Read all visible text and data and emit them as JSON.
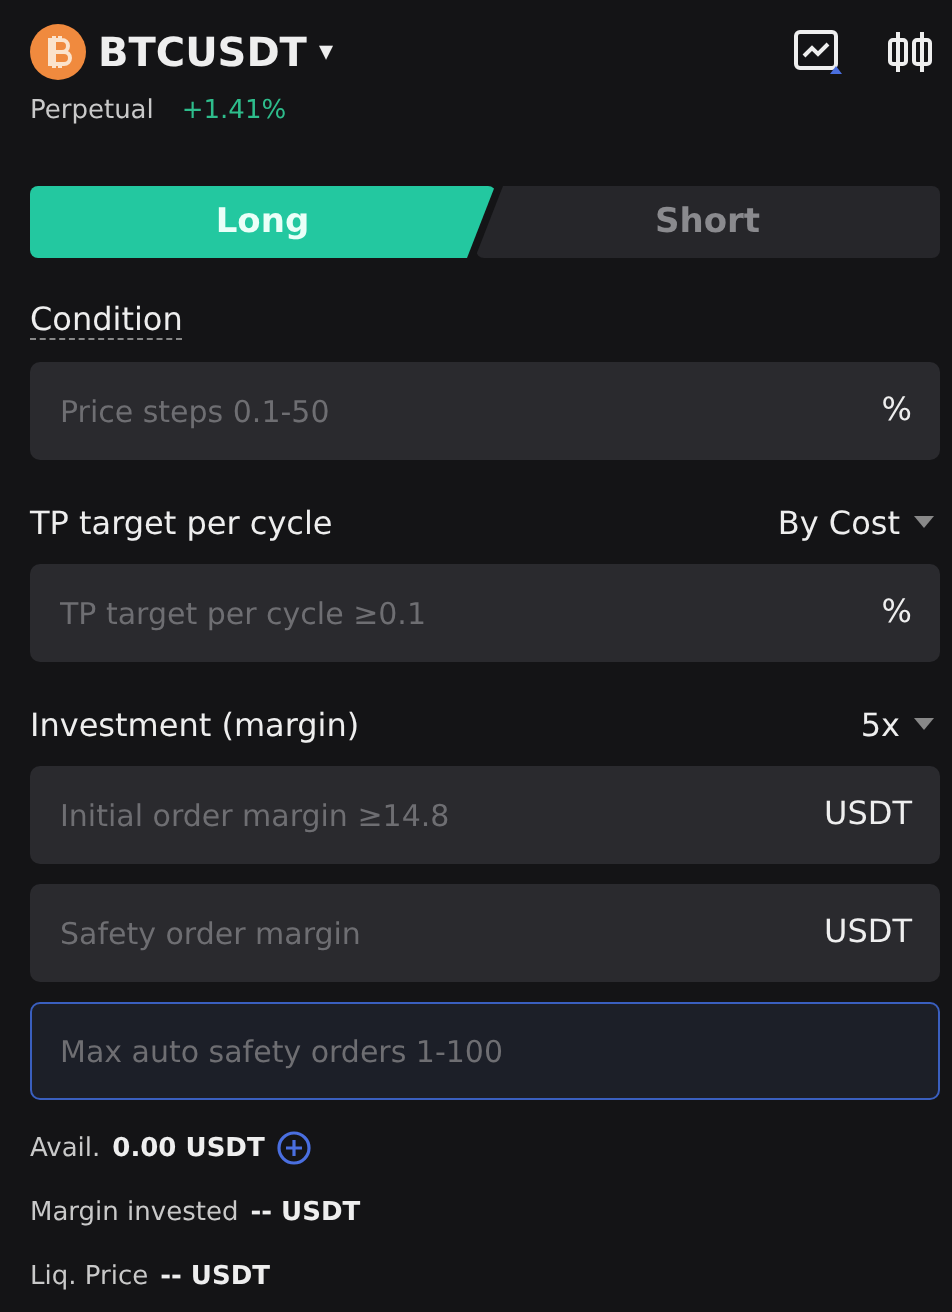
{
  "header": {
    "symbol": "BTCUSDT",
    "caret": "▾",
    "type": "Perpetual",
    "change": "+1.41%"
  },
  "tabs": [
    {
      "label": "Long",
      "selected": true
    },
    {
      "label": "Short",
      "selected": false
    }
  ],
  "sections": [
    {
      "label": "Condition",
      "underlined": true,
      "fields": [
        {
          "placeholder": "Price steps 0.1-50",
          "unit": "%",
          "focused": false
        }
      ]
    },
    {
      "label": "TP target per cycle",
      "underlined": false,
      "select": "By Cost",
      "fields": [
        {
          "placeholder": "TP target per cycle ≥0.1",
          "unit": "%",
          "focused": false
        }
      ]
    },
    {
      "label": "Investment (margin)",
      "underlined": false,
      "select": "5x",
      "fields": [
        {
          "placeholder": "Initial order margin ≥14.8",
          "unit": "USDT",
          "focused": false
        },
        {
          "placeholder": "Safety order margin",
          "unit": "USDT",
          "focused": false
        },
        {
          "placeholder": "Max auto safety orders 1-100",
          "focused": true
        }
      ]
    }
  ],
  "summary": [
    {
      "label": "Avail.",
      "value": "0.00 USDT",
      "add_button": true
    },
    {
      "label": "Margin invested",
      "value": "-- USDT",
      "add_button": false
    },
    {
      "label": "Liq. Price",
      "value": "-- USDT",
      "add_button": false
    }
  ]
}
